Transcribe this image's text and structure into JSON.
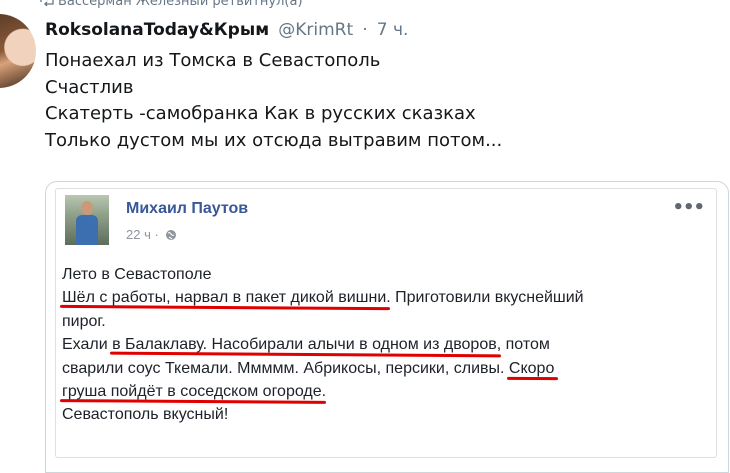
{
  "retweet": {
    "text": "Вассерман Железный ретвитнул(а)"
  },
  "tweet": {
    "author_name": "RoksolanaToday&Крым",
    "author_handle": "@KrimRt",
    "separator": "·",
    "time": "7 ч.",
    "lines": [
      "Понаехал из Томска в Севастополь",
      "Счастлив",
      "Скатерть -самобранка Как в русских сказках",
      "Только дустом мы их отсюда вытравим потом..."
    ]
  },
  "fb_post": {
    "author": "Михаил Паутов",
    "time": "22 ч",
    "separator": "·",
    "more_label": "•••",
    "text": {
      "l1": "Лето в Севастополе",
      "l2a": "Шёл с работы, нарвал в пакет дикой вишни",
      "l2b": ". Приготовили вкуснейший",
      "l3": "пирог.",
      "l4a": "Ехали ",
      "l4b": "в Балаклаву. Насобирали алычи в одном из дворов",
      "l4c": ", потом",
      "l5a": "сварили соус Ткемали. Ммммм. Абрикосы, персики, сливы. ",
      "l5b": "Скоро",
      "l6": "груша пойдёт в соседском огороде",
      "l6b": ".",
      "l7": "Севастополь вкусный!"
    }
  },
  "colors": {
    "underline": "#e00000",
    "fb_name": "#385898",
    "handle": "#657786"
  }
}
